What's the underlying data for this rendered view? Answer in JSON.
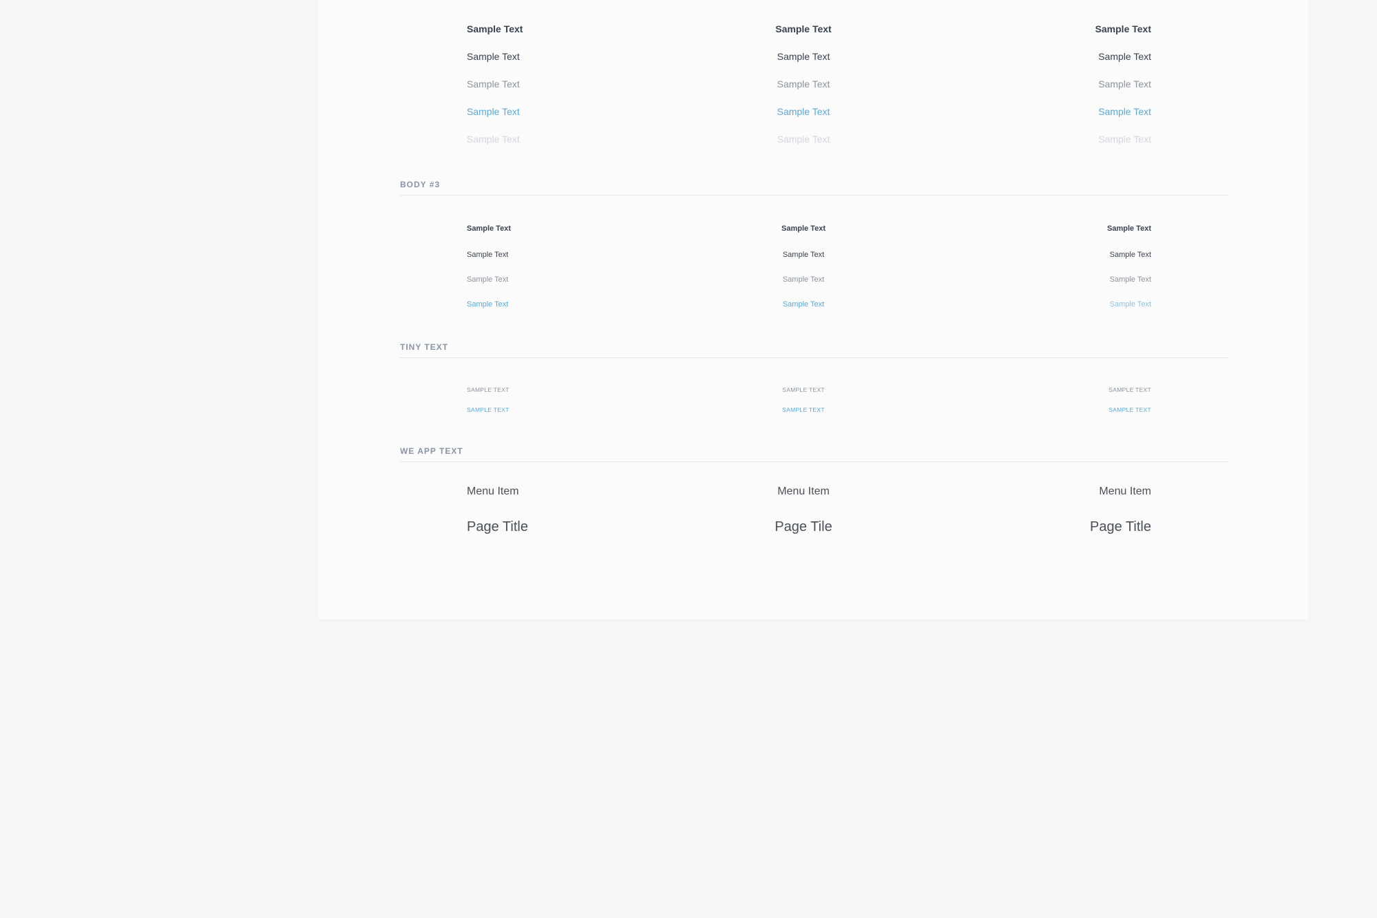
{
  "sections": {
    "body3": "BODY #3",
    "tiny": "TINY TEXT",
    "webapp": "WE APP TEXT"
  },
  "body2_rows": [
    [
      "Sample Text",
      "Sample Text",
      "Sample Text"
    ],
    [
      "Sample Text",
      "Sample Text",
      "Sample Text"
    ],
    [
      "Sample Text",
      "Sample Text",
      "Sample Text"
    ],
    [
      "Sample Text",
      "Sample Text",
      "Sample Text"
    ],
    [
      "Sample Text",
      "Sample Text",
      "Sample Text"
    ]
  ],
  "body3_rows": [
    [
      "Sample Text",
      "Sample Text",
      "Sample Text"
    ],
    [
      "Sample Text",
      "Sample Text",
      "Sample Text"
    ],
    [
      "Sample Text",
      "Sample Text",
      "Sample Text"
    ],
    [
      "Sample Text",
      "Sample Text",
      "Sample Text"
    ]
  ],
  "tiny_rows": [
    [
      "SAMPLE TEXT",
      "SAMPLE TEXT",
      "SAMPLE TEXT"
    ],
    [
      "SAMPLE TEXT",
      "SAMPLE TEXT",
      "SAMPLE TEXT"
    ]
  ],
  "app_rows": [
    [
      "Menu Item",
      "Menu Item",
      "Menu Item"
    ],
    [
      "Page Title",
      "Page Tile",
      "Page Title"
    ]
  ],
  "colors": {
    "dark": "#3a4352",
    "gray": "#8d949f",
    "blue": "#5aa9d6",
    "light": "#d3d7dd",
    "background": "#f5f6f8",
    "panel": "#fbfbfc"
  }
}
